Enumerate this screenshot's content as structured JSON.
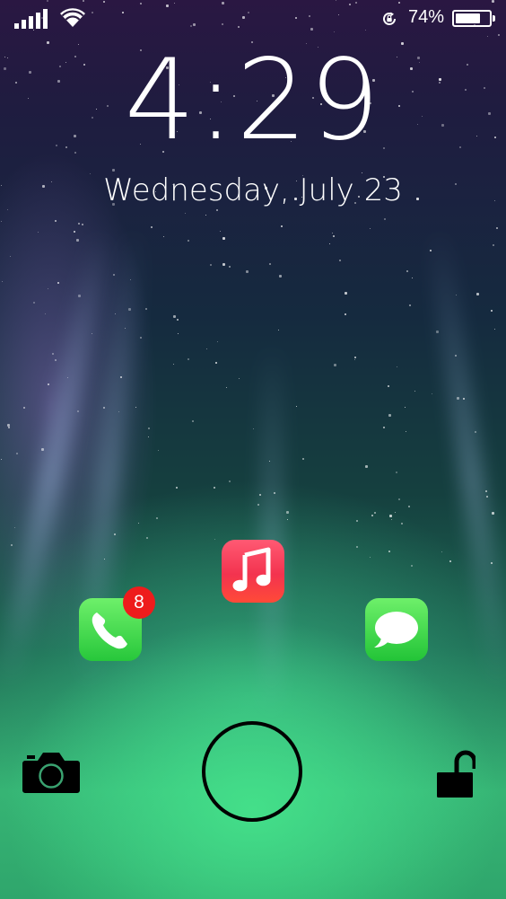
{
  "status_bar": {
    "battery_percent": "74%",
    "battery_level": 0.74,
    "signal_bars": 5,
    "icons": [
      "signal-icon",
      "wifi-icon",
      "rotation-lock-icon",
      "battery-icon"
    ]
  },
  "lock_screen": {
    "time": "4:29",
    "date": "Wednesday, July 23"
  },
  "apps": [
    {
      "name": "Music",
      "icon": "music-note-icon",
      "color": "#f3334f"
    },
    {
      "name": "Phone",
      "icon": "phone-icon",
      "color": "#27c73b",
      "badge": "8"
    },
    {
      "name": "Messages",
      "icon": "message-bubble-icon",
      "color": "#22c437"
    }
  ],
  "bottom_bar": {
    "icons": [
      "camera-icon",
      "home-ring",
      "unlock-icon"
    ]
  },
  "colors": {
    "badge": "#ee1c1c",
    "text": "#ffffff"
  }
}
